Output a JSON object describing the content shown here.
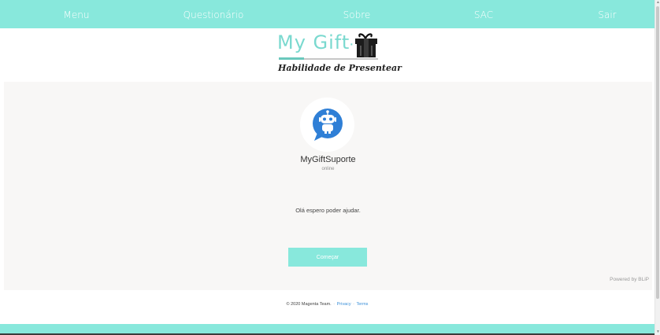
{
  "nav": {
    "items": [
      {
        "label": "Menu",
        "id": "menu"
      },
      {
        "label": "Questionário",
        "id": "questionario"
      },
      {
        "label": "Sobre",
        "id": "sobre"
      },
      {
        "label": "SAC",
        "id": "sac"
      },
      {
        "label": "Sair",
        "id": "sair"
      }
    ]
  },
  "header": {
    "logo_text": "My Gift",
    "logo_dot": "·",
    "tagline": "Habilidade de Presentear"
  },
  "chat": {
    "bot_name": "MyGiftSuporte",
    "status": "online",
    "welcome_message": "Olá espero poder ajudar.",
    "start_label": "Começar",
    "powered_by": "Powered by BLiP"
  },
  "footer": {
    "copyright": "© 2020 Magenta Team.",
    "sep1": "·",
    "privacy": "Privacy",
    "sep2": "·",
    "terms": "Terms"
  },
  "colors": {
    "accent": "#88e8dc",
    "panel_bg": "#f8f7f6",
    "bot_blue": "#2f7fd6",
    "link": "#3a8fd8"
  }
}
